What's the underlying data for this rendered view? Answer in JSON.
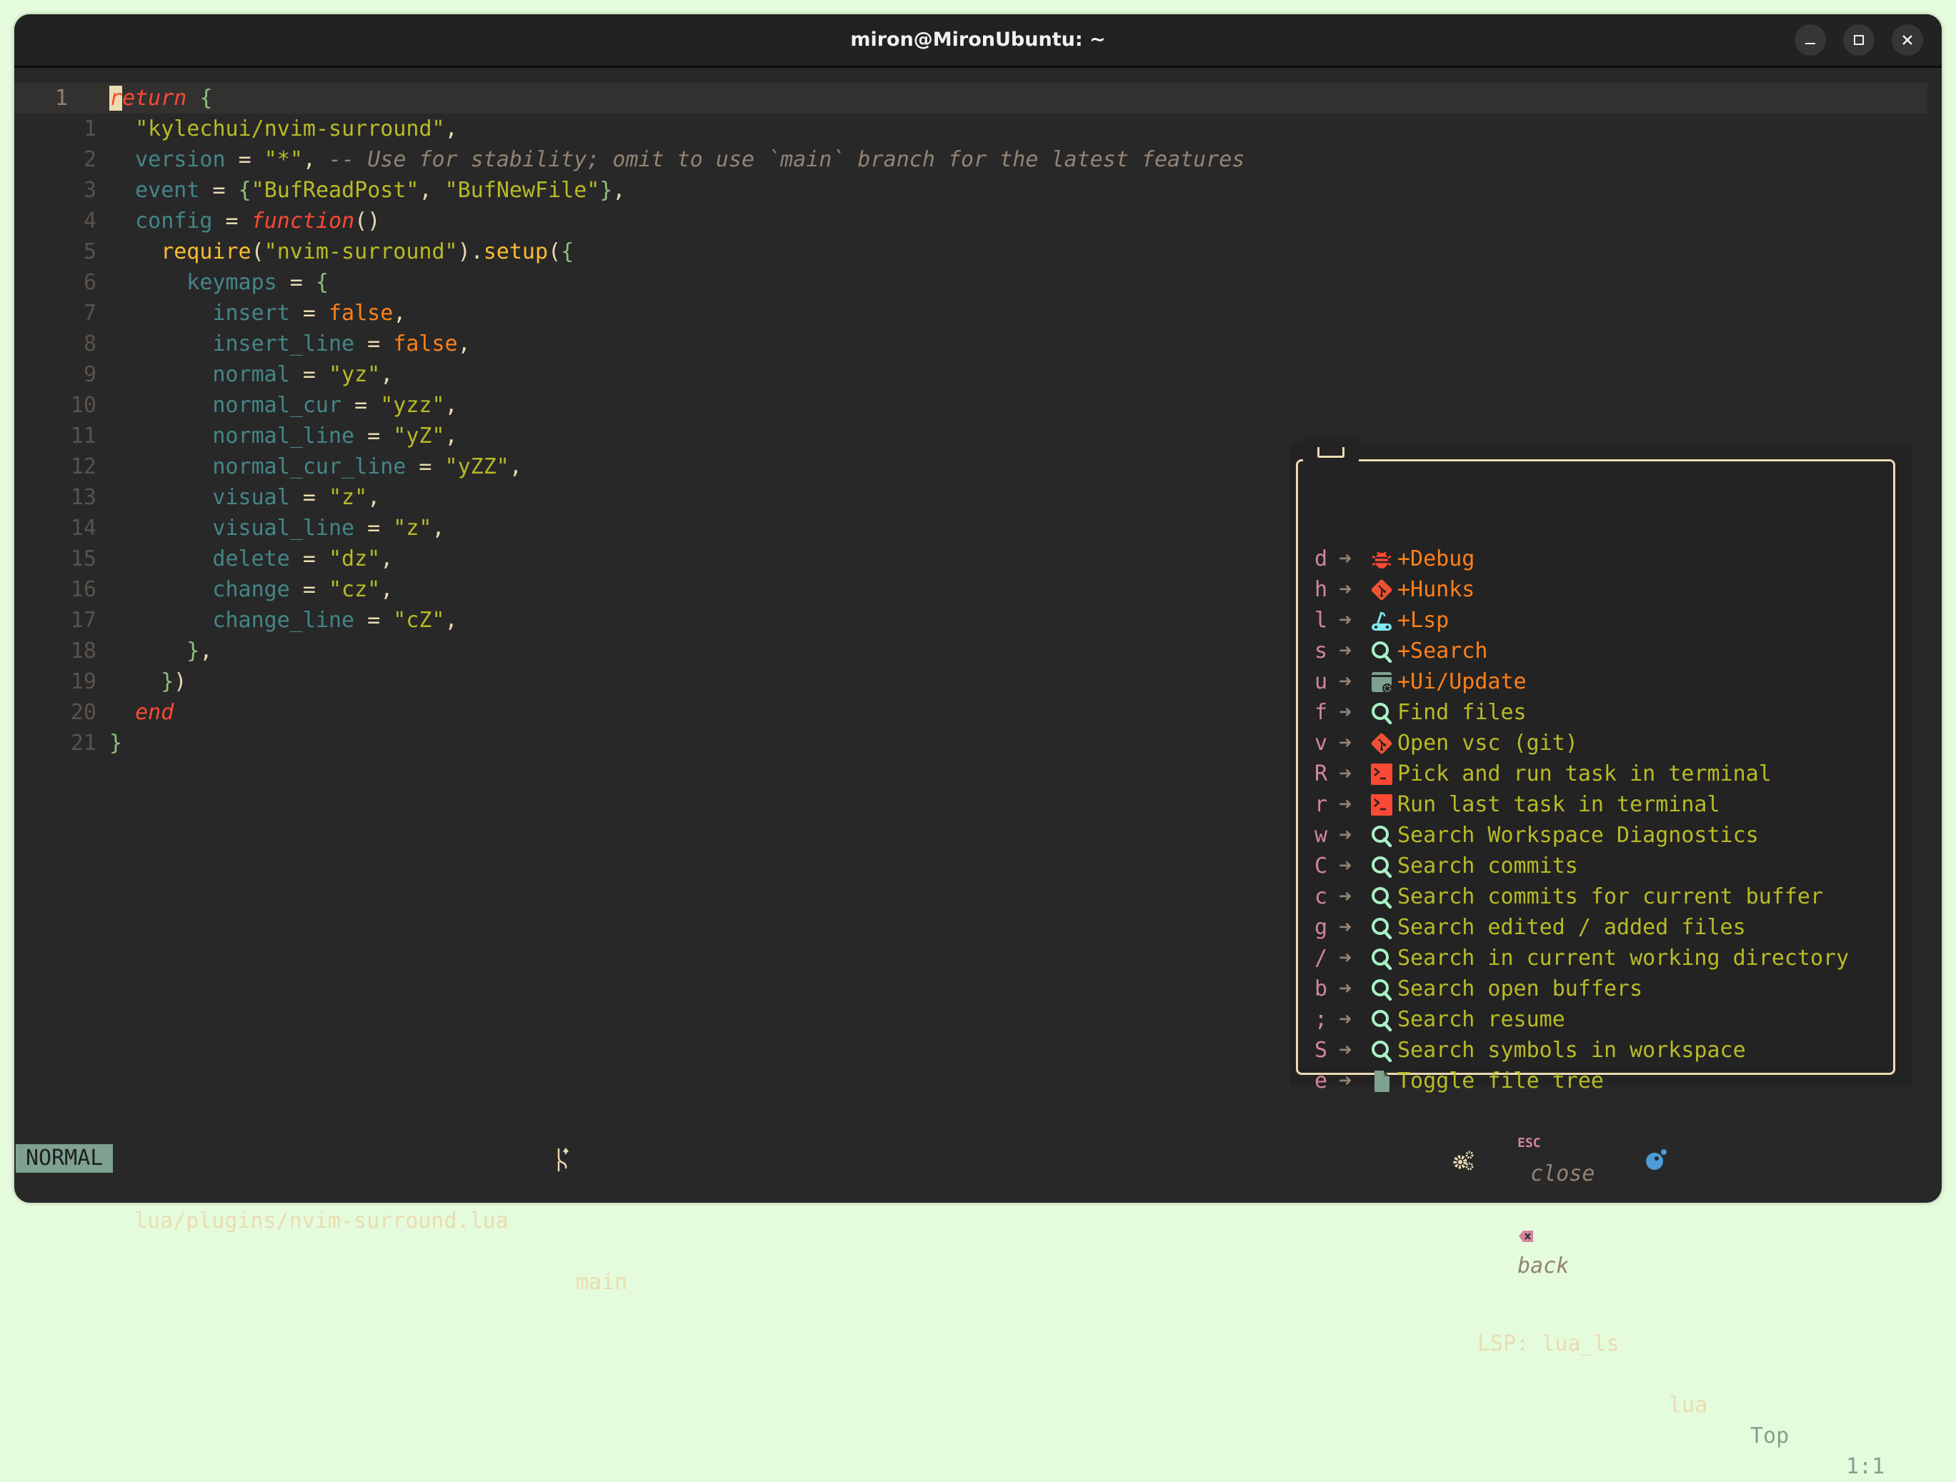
{
  "window": {
    "title": "miron@MironUbuntu: ~",
    "controls": [
      "minimize",
      "maximize",
      "close"
    ]
  },
  "editor": {
    "current_line_number": "1",
    "lines": [
      {
        "num": "1",
        "current": true,
        "tokens": [
          {
            "t": "r",
            "c": "cursor-kw"
          },
          {
            "t": "eturn",
            "c": "kw"
          },
          {
            "t": " "
          },
          {
            "t": "{",
            "c": "br"
          }
        ]
      },
      {
        "num": "1",
        "indent": 1,
        "tokens": [
          {
            "t": "\"kylechui/nvim-surround\"",
            "c": "str"
          },
          {
            "t": ",",
            "c": "op"
          }
        ]
      },
      {
        "num": "2",
        "indent": 1,
        "tokens": [
          {
            "t": "version",
            "c": "field"
          },
          {
            "t": " = ",
            "c": "op"
          },
          {
            "t": "\"*\"",
            "c": "str"
          },
          {
            "t": ", ",
            "c": "op"
          },
          {
            "t": "-- Use for stability; omit to use `main` branch for the latest features",
            "c": "cm"
          }
        ]
      },
      {
        "num": "3",
        "indent": 1,
        "tokens": [
          {
            "t": "event",
            "c": "field"
          },
          {
            "t": " = ",
            "c": "op"
          },
          {
            "t": "{",
            "c": "br"
          },
          {
            "t": "\"BufReadPost\"",
            "c": "str"
          },
          {
            "t": ", ",
            "c": "op"
          },
          {
            "t": "\"BufNewFile\"",
            "c": "str"
          },
          {
            "t": "}",
            "c": "br"
          },
          {
            "t": ",",
            "c": "op"
          }
        ]
      },
      {
        "num": "4",
        "indent": 1,
        "tokens": [
          {
            "t": "config",
            "c": "field"
          },
          {
            "t": " = ",
            "c": "op"
          },
          {
            "t": "function",
            "c": "kw"
          },
          {
            "t": "()",
            "c": "op"
          }
        ]
      },
      {
        "num": "5",
        "indent": 2,
        "tokens": [
          {
            "t": "require",
            "c": "fn"
          },
          {
            "t": "(",
            "c": "op"
          },
          {
            "t": "\"nvim-surround\"",
            "c": "str"
          },
          {
            "t": ").",
            "c": "op"
          },
          {
            "t": "setup",
            "c": "fn"
          },
          {
            "t": "(",
            "c": "op"
          },
          {
            "t": "{",
            "c": "br"
          }
        ]
      },
      {
        "num": "6",
        "indent": 3,
        "tokens": [
          {
            "t": "keymaps",
            "c": "field"
          },
          {
            "t": " = ",
            "c": "op"
          },
          {
            "t": "{",
            "c": "br"
          }
        ]
      },
      {
        "num": "7",
        "indent": 4,
        "tokens": [
          {
            "t": "insert",
            "c": "field"
          },
          {
            "t": " = ",
            "c": "op"
          },
          {
            "t": "false",
            "c": "bool"
          },
          {
            "t": ",",
            "c": "op"
          }
        ]
      },
      {
        "num": "8",
        "indent": 4,
        "tokens": [
          {
            "t": "insert_line",
            "c": "field"
          },
          {
            "t": " = ",
            "c": "op"
          },
          {
            "t": "false",
            "c": "bool"
          },
          {
            "t": ",",
            "c": "op"
          }
        ]
      },
      {
        "num": "9",
        "indent": 4,
        "tokens": [
          {
            "t": "normal",
            "c": "field"
          },
          {
            "t": " = ",
            "c": "op"
          },
          {
            "t": "\"yz\"",
            "c": "str"
          },
          {
            "t": ",",
            "c": "op"
          }
        ]
      },
      {
        "num": "10",
        "indent": 4,
        "tokens": [
          {
            "t": "normal_cur",
            "c": "field"
          },
          {
            "t": " = ",
            "c": "op"
          },
          {
            "t": "\"yzz\"",
            "c": "str"
          },
          {
            "t": ",",
            "c": "op"
          }
        ]
      },
      {
        "num": "11",
        "indent": 4,
        "tokens": [
          {
            "t": "normal_line",
            "c": "field"
          },
          {
            "t": " = ",
            "c": "op"
          },
          {
            "t": "\"yZ\"",
            "c": "str"
          },
          {
            "t": ",",
            "c": "op"
          }
        ]
      },
      {
        "num": "12",
        "indent": 4,
        "tokens": [
          {
            "t": "normal_cur_line",
            "c": "field"
          },
          {
            "t": " = ",
            "c": "op"
          },
          {
            "t": "\"yZZ\"",
            "c": "str"
          },
          {
            "t": ",",
            "c": "op"
          }
        ]
      },
      {
        "num": "13",
        "indent": 4,
        "tokens": [
          {
            "t": "visual",
            "c": "field"
          },
          {
            "t": " = ",
            "c": "op"
          },
          {
            "t": "\"z\"",
            "c": "str"
          },
          {
            "t": ",",
            "c": "op"
          }
        ]
      },
      {
        "num": "14",
        "indent": 4,
        "tokens": [
          {
            "t": "visual_line",
            "c": "field"
          },
          {
            "t": " = ",
            "c": "op"
          },
          {
            "t": "\"z\"",
            "c": "str"
          },
          {
            "t": ",",
            "c": "op"
          }
        ]
      },
      {
        "num": "15",
        "indent": 4,
        "tokens": [
          {
            "t": "delete",
            "c": "field"
          },
          {
            "t": " = ",
            "c": "op"
          },
          {
            "t": "\"dz\"",
            "c": "str"
          },
          {
            "t": ",",
            "c": "op"
          }
        ]
      },
      {
        "num": "16",
        "indent": 4,
        "tokens": [
          {
            "t": "change",
            "c": "field"
          },
          {
            "t": " = ",
            "c": "op"
          },
          {
            "t": "\"cz\"",
            "c": "str"
          },
          {
            "t": ",",
            "c": "op"
          }
        ]
      },
      {
        "num": "17",
        "indent": 4,
        "tokens": [
          {
            "t": "change_line",
            "c": "field"
          },
          {
            "t": " = ",
            "c": "op"
          },
          {
            "t": "\"cZ\"",
            "c": "str"
          },
          {
            "t": ",",
            "c": "op"
          }
        ]
      },
      {
        "num": "18",
        "indent": 3,
        "tokens": [
          {
            "t": "}",
            "c": "br"
          },
          {
            "t": ",",
            "c": "op"
          }
        ]
      },
      {
        "num": "19",
        "indent": 2,
        "tokens": [
          {
            "t": "}",
            "c": "br"
          },
          {
            "t": ")",
            "c": "op"
          }
        ]
      },
      {
        "num": "20",
        "indent": 1,
        "tokens": [
          {
            "t": "end",
            "c": "kw"
          }
        ]
      },
      {
        "num": "21",
        "indent": 0,
        "tokens": [
          {
            "t": "}",
            "c": "br"
          }
        ]
      }
    ]
  },
  "whichkey": {
    "items": [
      {
        "key": "d",
        "icon": "bug-icon",
        "icon_color": "#fb4934",
        "label": "+Debug",
        "group": true
      },
      {
        "key": "h",
        "icon": "git-icon",
        "icon_color": "#f05133",
        "label": "+Hunks",
        "group": true
      },
      {
        "key": "l",
        "icon": "lsp-gear-icon",
        "icon_color": "#7fe8f0",
        "label": "+Lsp",
        "group": true
      },
      {
        "key": "s",
        "icon": "search-icon",
        "icon_color": "#a9f0c6",
        "label": "+Search",
        "group": true
      },
      {
        "key": "u",
        "icon": "ui-settings-icon",
        "icon_color": "#7fa190",
        "label": "+Ui/Update",
        "group": true
      },
      {
        "key": "f",
        "icon": "search-icon",
        "icon_color": "#a9f0c6",
        "label": "Find files",
        "group": false
      },
      {
        "key": "v",
        "icon": "git-icon",
        "icon_color": "#f05133",
        "label": "Open vsc (git)",
        "group": false
      },
      {
        "key": "R",
        "icon": "terminal-icon",
        "icon_color": "#fb4934",
        "label": "Pick and run task in terminal",
        "group": false
      },
      {
        "key": "r",
        "icon": "terminal-icon",
        "icon_color": "#fb4934",
        "label": "Run last task in terminal",
        "group": false
      },
      {
        "key": "w",
        "icon": "search-icon",
        "icon_color": "#a9f0c6",
        "label": "Search Workspace Diagnostics",
        "group": false
      },
      {
        "key": "C",
        "icon": "search-icon",
        "icon_color": "#a9f0c6",
        "label": "Search commits",
        "group": false
      },
      {
        "key": "c",
        "icon": "search-icon",
        "icon_color": "#a9f0c6",
        "label": "Search commits for current buffer",
        "group": false
      },
      {
        "key": "g",
        "icon": "search-icon",
        "icon_color": "#a9f0c6",
        "label": "Search edited / added files",
        "group": false
      },
      {
        "key": "/",
        "icon": "search-icon",
        "icon_color": "#a9f0c6",
        "label": "Search in current working directory",
        "group": false
      },
      {
        "key": "b",
        "icon": "search-icon",
        "icon_color": "#a9f0c6",
        "label": "Search open buffers",
        "group": false
      },
      {
        "key": ";",
        "icon": "search-icon",
        "icon_color": "#a9f0c6",
        "label": "Search resume",
        "group": false
      },
      {
        "key": "S",
        "icon": "search-icon",
        "icon_color": "#a9f0c6",
        "label": "Search symbols in workspace",
        "group": false
      },
      {
        "key": "e",
        "icon": "file-icon",
        "icon_color": "#7fa190",
        "label": "Toggle file tree",
        "group": false
      }
    ],
    "arrow": "➜",
    "footer": {
      "esc_key": "ESC",
      "close_label": "close",
      "back_key": "⌫",
      "back_label": "back"
    }
  },
  "statusline": {
    "mode": "NORMAL",
    "file": "lua/plugins/nvim-surround.lua",
    "branch": "main",
    "lsp": "LSP: lua_ls",
    "filetype": "lua",
    "scroll": "Top",
    "position": "1:1"
  }
}
